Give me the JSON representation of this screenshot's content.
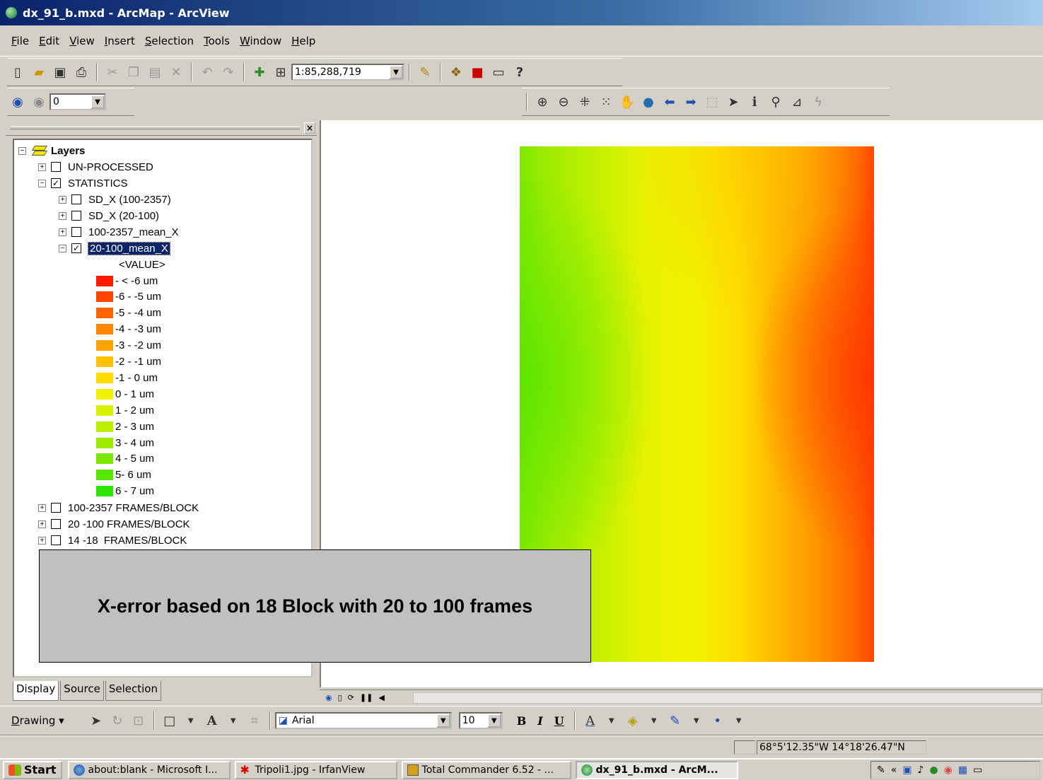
{
  "window": {
    "title": "dx_91_b.mxd - ArcMap - ArcView"
  },
  "menu": [
    "File",
    "Edit",
    "View",
    "Insert",
    "Selection",
    "Tools",
    "Window",
    "Help"
  ],
  "standard_toolbar": {
    "scale_value": "1:85,288,719"
  },
  "georef_toolbar": {
    "layer_value": "0"
  },
  "toc": {
    "root": "Layers",
    "groups": [
      {
        "label": "UN-PROCESSED",
        "checked": false
      },
      {
        "label": "STATISTICS",
        "checked": true
      }
    ],
    "stat_layers": [
      {
        "label": "SD_X (100-2357)",
        "checked": false
      },
      {
        "label": "SD_X (20-100)",
        "checked": false
      },
      {
        "label": "100-2357_mean_X",
        "checked": false
      },
      {
        "label": "20-100_mean_X",
        "checked": true
      }
    ],
    "value_header": "<VALUE>",
    "legend": [
      {
        "label": "- < -6 um",
        "color": "#ff1a00"
      },
      {
        "label": "-6 - -5 um",
        "color": "#ff4500"
      },
      {
        "label": "-5 - -4 um",
        "color": "#ff6600"
      },
      {
        "label": "-4 - -3 um",
        "color": "#ff8500"
      },
      {
        "label": "-3 - -2 um",
        "color": "#ffa200"
      },
      {
        "label": "-2 - -1 um",
        "color": "#ffc000"
      },
      {
        "label": "-1 - 0 um",
        "color": "#ffdd00"
      },
      {
        "label": "0 - 1 um",
        "color": "#f2f200"
      },
      {
        "label": "1 - 2 um",
        "color": "#d8f200"
      },
      {
        "label": "2 - 3 um",
        "color": "#bdf000"
      },
      {
        "label": "3 - 4 um",
        "color": "#9eeb00"
      },
      {
        "label": "4 - 5 um",
        "color": "#7ce800"
      },
      {
        "label": "5- 6 um",
        "color": "#55e500"
      },
      {
        "label": "6 - 7 um",
        "color": "#2ee400"
      }
    ],
    "other_layers": [
      {
        "label": "100-2357 FRAMES/BLOCK",
        "checked": false
      },
      {
        "label": "20 -100 FRAMES/BLOCK",
        "checked": false
      },
      {
        "label": "14 -18  FRAMES/BLOCK",
        "checked": false
      }
    ],
    "tabs": [
      "Display",
      "Source",
      "Selection"
    ]
  },
  "caption": "X-error based on 18 Block with 20 to 100 frames",
  "drawing_toolbar": {
    "label": "Drawing",
    "font_name": "Arial",
    "font_size": "10",
    "bold": "B",
    "italic": "I",
    "underline": "U",
    "font_color_glyph": "A",
    "text_tool_glyph": "A"
  },
  "status": {
    "coordinates": "68°5'12.35\"W  14°18'26.47\"N"
  },
  "taskbar": {
    "start": "Start",
    "tasks": [
      {
        "label": "about:blank - Microsoft I...",
        "active": false
      },
      {
        "label": "Tripoli1.jpg - IrfanView",
        "active": false
      },
      {
        "label": "Total Commander 6.52 - ...",
        "active": false
      },
      {
        "label": "dx_91_b.mxd - ArcM...",
        "active": true
      }
    ]
  }
}
